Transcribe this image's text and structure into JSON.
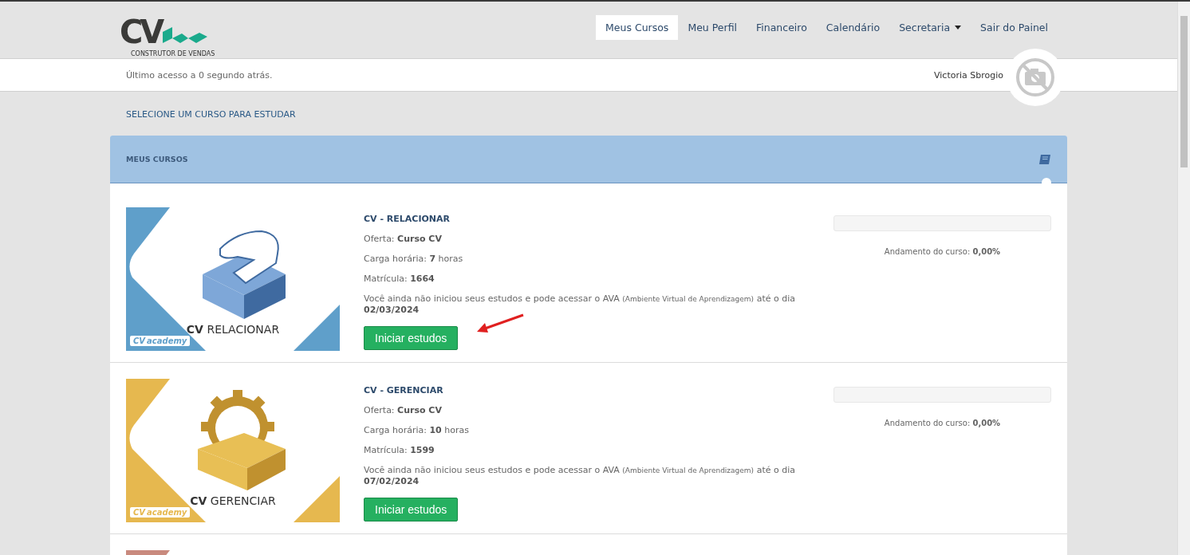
{
  "logo": {
    "mark": "CV",
    "tagline": "CONSTRUTOR DE VENDAS"
  },
  "nav": [
    {
      "label": "Meus Cursos",
      "selected": true,
      "dropdown": false
    },
    {
      "label": "Meu Perfil",
      "selected": false,
      "dropdown": false
    },
    {
      "label": "Financeiro",
      "selected": false,
      "dropdown": false
    },
    {
      "label": "Calendário",
      "selected": false,
      "dropdown": false
    },
    {
      "label": "Secretaria",
      "selected": false,
      "dropdown": true
    },
    {
      "label": "Sair do Painel",
      "selected": false,
      "dropdown": false
    }
  ],
  "info_bar": {
    "last_access": "Último acesso a 0 segundo atrás.",
    "user_name": "Victoria Sbrogio"
  },
  "section_heading": "SELECIONE UM CURSO PARA ESTUDAR",
  "panel": {
    "title": "MEUS CURSOS",
    "courses": [
      {
        "kind": "full",
        "banner": {
          "kind": "hand",
          "color": "#5f9fca"
        },
        "banner_title": "**CV** RELACIONAR",
        "badge_mark": "CV",
        "badge_text": "academy",
        "title": "CV - RELACIONAR",
        "offer": "Oferta: **Curso CV**",
        "workload": "Carga horária: **7** horas",
        "enrollment": "Matrícula: **1664**",
        "notice": "Você ainda não iniciou seus estudos e pode acessar o AVA",
        "notice_note": "(Ambiente Virtual de Aprendizagem)",
        "notice_end": "até o dia",
        "deadline": "02/03/2024",
        "button": "Iniciar estudos",
        "arrow_marked": true,
        "progress": {
          "level": 0,
          "label": "Andamento do curso: **0,00%**"
        }
      },
      {
        "kind": "full",
        "banner": {
          "kind": "gear",
          "color": "#e6b84f"
        },
        "banner_title": "**CV** GERENCIAR",
        "badge_mark": "CV",
        "badge_text": "academy",
        "title": "CV - GERENCIAR",
        "offer": "Oferta: **Curso CV**",
        "workload": "Carga horária: **10** horas",
        "enrollment": "Matrícula: **1599**",
        "notice": "Você ainda não iniciou seus estudos e pode acessar o AVA",
        "notice_note": "(Ambiente Virtual de Aprendizagem)",
        "notice_end": "até o dia",
        "deadline": "07/02/2024",
        "button": "Iniciar estudos",
        "arrow_marked": false,
        "progress": {
          "level": 0,
          "label": "Andamento do curso: **0,00%**"
        }
      },
      {
        "kind": "cut_off",
        "banner": {
          "kind": "none",
          "color": "#c98a7e"
        }
      }
    ]
  }
}
